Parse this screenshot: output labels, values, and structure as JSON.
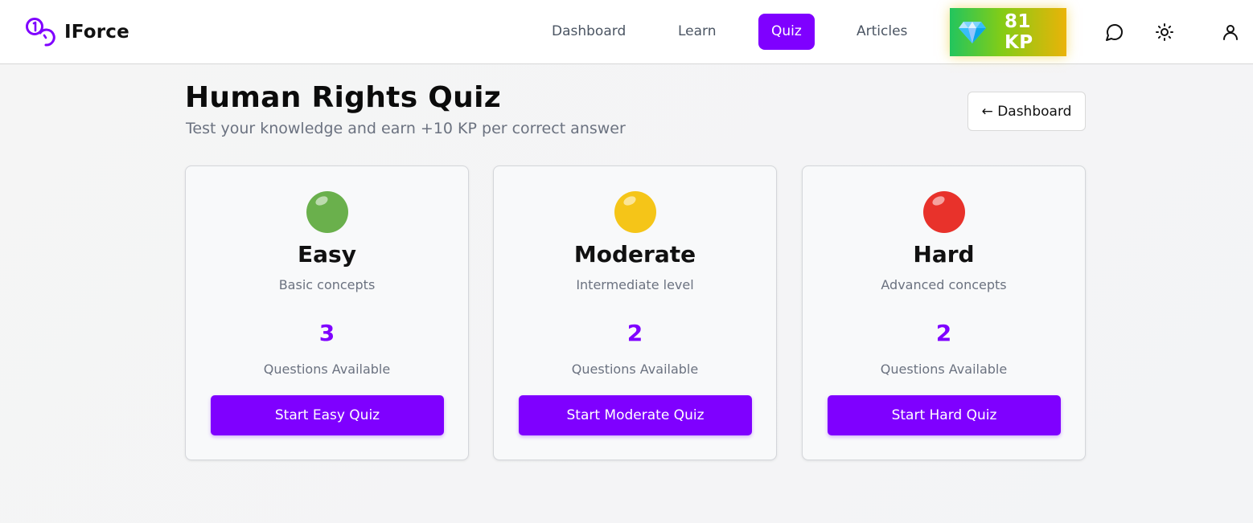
{
  "brand": {
    "name": "IForce"
  },
  "nav": [
    {
      "label": "Dashboard",
      "active": false
    },
    {
      "label": "Learn",
      "active": false
    },
    {
      "label": "Quiz",
      "active": true
    },
    {
      "label": "Articles",
      "active": false
    }
  ],
  "kp": {
    "value": "81 KP",
    "icon": "gem-icon"
  },
  "header_icons": [
    "chat-icon",
    "sun-icon",
    "user-icon"
  ],
  "page": {
    "title": "Human Rights Quiz",
    "subtitle": "Test your knowledge and earn +10 KP per correct answer",
    "back_label": "← Dashboard"
  },
  "cards": [
    {
      "color": "#6ab04c",
      "title": "Easy",
      "description": "Basic concepts",
      "count": "3",
      "count_label": "Questions Available",
      "button": "Start Easy Quiz"
    },
    {
      "color": "#f5c518",
      "title": "Moderate",
      "description": "Intermediate level",
      "count": "2",
      "count_label": "Questions Available",
      "button": "Start Moderate Quiz"
    },
    {
      "color": "#e8322b",
      "title": "Hard",
      "description": "Advanced concepts",
      "count": "2",
      "count_label": "Questions Available",
      "button": "Start Hard Quiz"
    }
  ],
  "colors": {
    "accent": "#7f00ff",
    "muted_text": "#6b7280"
  }
}
